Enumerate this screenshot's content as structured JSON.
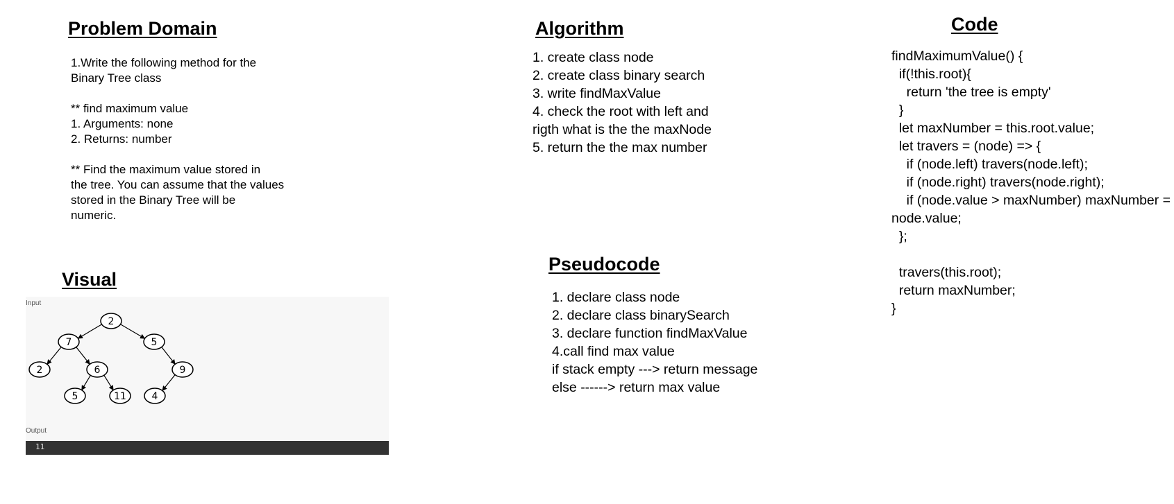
{
  "problem_domain": {
    "title": "Problem Domain",
    "lines": [
      "1.Write the following method for the",
      "Binary Tree class",
      "",
      "** find maximum value",
      "1. Arguments: none",
      "2. Returns: number",
      "",
      "** Find the maximum value stored in",
      "the tree. You can assume that the values",
      "stored in the Binary Tree will be",
      "numeric."
    ]
  },
  "algorithm": {
    "title": "Algorithm",
    "lines": [
      "1. create class node",
      "2. create class binary search",
      "3. write findMaxValue",
      "4. check the root with left and",
      "rigth what is the the maxNode",
      "5. return the the max number"
    ]
  },
  "code": {
    "title": "Code",
    "lines": [
      "findMaximumValue() {",
      "  if(!this.root){",
      "    return 'the tree is empty'",
      "  }",
      "  let maxNumber = this.root.value;",
      "  let travers = (node) => {",
      "    if (node.left) travers(node.left);",
      "    if (node.right) travers(node.right);",
      "    if (node.value > maxNumber) maxNumber =",
      "node.value;",
      "  };",
      "",
      "  travers(this.root);",
      "  return maxNumber;",
      "}"
    ]
  },
  "pseudocode": {
    "title": "Pseudocode",
    "lines": [
      "1. declare class node",
      "2. declare class binarySearch",
      "3. declare function findMaxValue",
      "4.call find max value",
      "if stack empty ---> return message",
      "else ------> return max value"
    ]
  },
  "visual": {
    "title": "Visual",
    "input_label": "Input",
    "output_label": "Output",
    "output_value": "11",
    "tree_nodes": [
      {
        "id": "n2a",
        "value": "2"
      },
      {
        "id": "n7",
        "value": "7"
      },
      {
        "id": "n5a",
        "value": "5"
      },
      {
        "id": "n2b",
        "value": "2"
      },
      {
        "id": "n6",
        "value": "6"
      },
      {
        "id": "n9",
        "value": "9"
      },
      {
        "id": "n5b",
        "value": "5"
      },
      {
        "id": "n11",
        "value": "11"
      },
      {
        "id": "n4",
        "value": "4"
      }
    ],
    "tree_edges": [
      [
        "n2a",
        "n7"
      ],
      [
        "n2a",
        "n5a"
      ],
      [
        "n7",
        "n2b"
      ],
      [
        "n7",
        "n6"
      ],
      [
        "n5a",
        "n9"
      ],
      [
        "n6",
        "n5b"
      ],
      [
        "n6",
        "n11"
      ],
      [
        "n9",
        "n4"
      ]
    ]
  }
}
